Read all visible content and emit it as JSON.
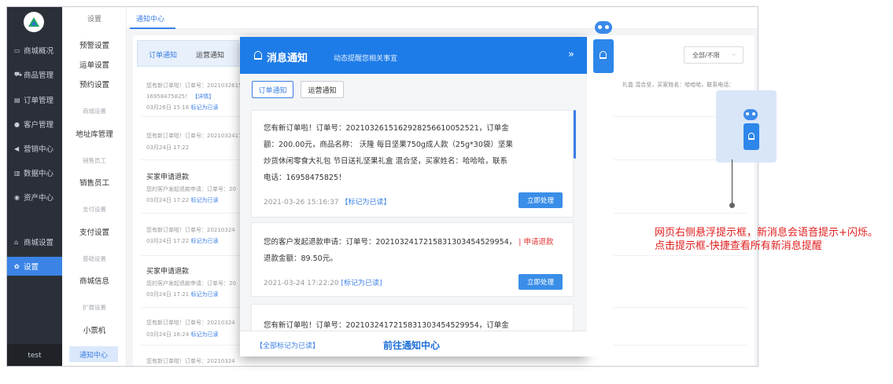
{
  "sidebar": {
    "items": [
      {
        "icon": "shop-icon",
        "glyph": "▭",
        "label": "商城概况"
      },
      {
        "icon": "cart-icon",
        "glyph": "⛟",
        "label": "商品管理"
      },
      {
        "icon": "order-icon",
        "glyph": "▤",
        "label": "订单管理"
      },
      {
        "icon": "user-icon",
        "glyph": "●",
        "label": "客户管理"
      },
      {
        "icon": "marketing-icon",
        "glyph": "◀",
        "label": "营销中心"
      },
      {
        "icon": "data-icon",
        "glyph": "▥",
        "label": "数据中心"
      },
      {
        "icon": "asset-icon",
        "glyph": "◉",
        "label": "资产中心"
      },
      {
        "icon": "home-icon",
        "glyph": "⌂",
        "label": "商城设置"
      },
      {
        "icon": "gear-icon",
        "glyph": "✿",
        "label": "设置"
      }
    ],
    "footer": "test"
  },
  "submenu": {
    "header": "设置",
    "items": [
      "预警设置",
      "运单设置",
      "预约设置"
    ],
    "group_shop": "商城设置",
    "address": "地址库管理",
    "group_staff": "销售员工",
    "staff": "销售员工",
    "group_pay": "支付设置",
    "pay": "支付设置",
    "group_basic": "基础设置",
    "shop_info": "商城信息",
    "group_ext": "扩展设置",
    "ticket": "小票机",
    "active": "通知中心"
  },
  "topbar": {
    "tab": "通知中心"
  },
  "background": {
    "tab_order": "订单通知",
    "tab_ops": "运营通知",
    "filter_value": "全部/不限",
    "right_text": "礼盒 混合坚，买家姓名：哈哈哈，联系电话：",
    "rows": [
      {
        "text": "您有新订单啦！订单号：2021032615",
        "extra": "16958475825！",
        "link": "【详情】",
        "time": "03月26日 15:16",
        "mark": "标记为已读"
      },
      {
        "text": "您有新订单啦！订单号：2021032417",
        "time": "03月24日 17:22"
      },
      {
        "title": "买家申请退款",
        "text": "您的客户发起退款申请：订单号：20",
        "time": "03月24日 17:22",
        "mark": "标记为已读"
      },
      {
        "text": "您有新订单啦！订单号：20210324",
        "time": "03月24日 17:22",
        "mark": "标记为已读"
      },
      {
        "title": "买家申请退款",
        "text": "您的客户发起退款申请：订单号：20",
        "time": "03月24日 17:21",
        "mark": "标记为已读"
      },
      {
        "text": "您有新订单啦！订单号：20210324",
        "time": "03月24日 16:24",
        "mark": "标记为已读"
      },
      {
        "text": "您有新订单啦！订单号：20210324",
        "time": "03月24日 16:23",
        "mark": "标记为已读"
      }
    ]
  },
  "panel": {
    "title": "消息通知",
    "subtitle": "动态提醒您相关事宜",
    "collapse": "»",
    "tab_order": "订单通知",
    "tab_ops": "运营通知",
    "cards": [
      {
        "lines": [
          "您有新订单啦！订单号：2021032615162928256610052521，订单金",
          "额：200.00元，商品名称：  沃隆 每日坚果750g成人款（25g*30袋）坚果",
          "炒货休闲零食大礼包 节日送礼坚果礼盒 混合坚，买家姓名：哈哈哈，联系",
          "电话：16958475825！"
        ],
        "time": "2021-03-26 15:16:37",
        "mark": "【标记为已读】",
        "button": "立即处理"
      },
      {
        "line1": "您的客户发起退款申请：订单号：20210324172158313034545299​54，",
        "sep": "|",
        "tag": "申请退款",
        "line2": "退款金额：89.50元。",
        "time": "2021-03-24 17:22:20",
        "mark": "[标记为已读]",
        "button": "立即处理"
      },
      {
        "line1": "您有新订单啦！订单号：2021032417215831303454529954，订单金"
      }
    ],
    "footer_left": "【全部标记为已读】",
    "footer_center": "前往通知中心"
  },
  "annotation": {
    "line1": "网页右侧悬浮提示框，新消息会语音提示+闪烁。",
    "line2": "点击提示框-快捷查看所有新消息提醒"
  }
}
